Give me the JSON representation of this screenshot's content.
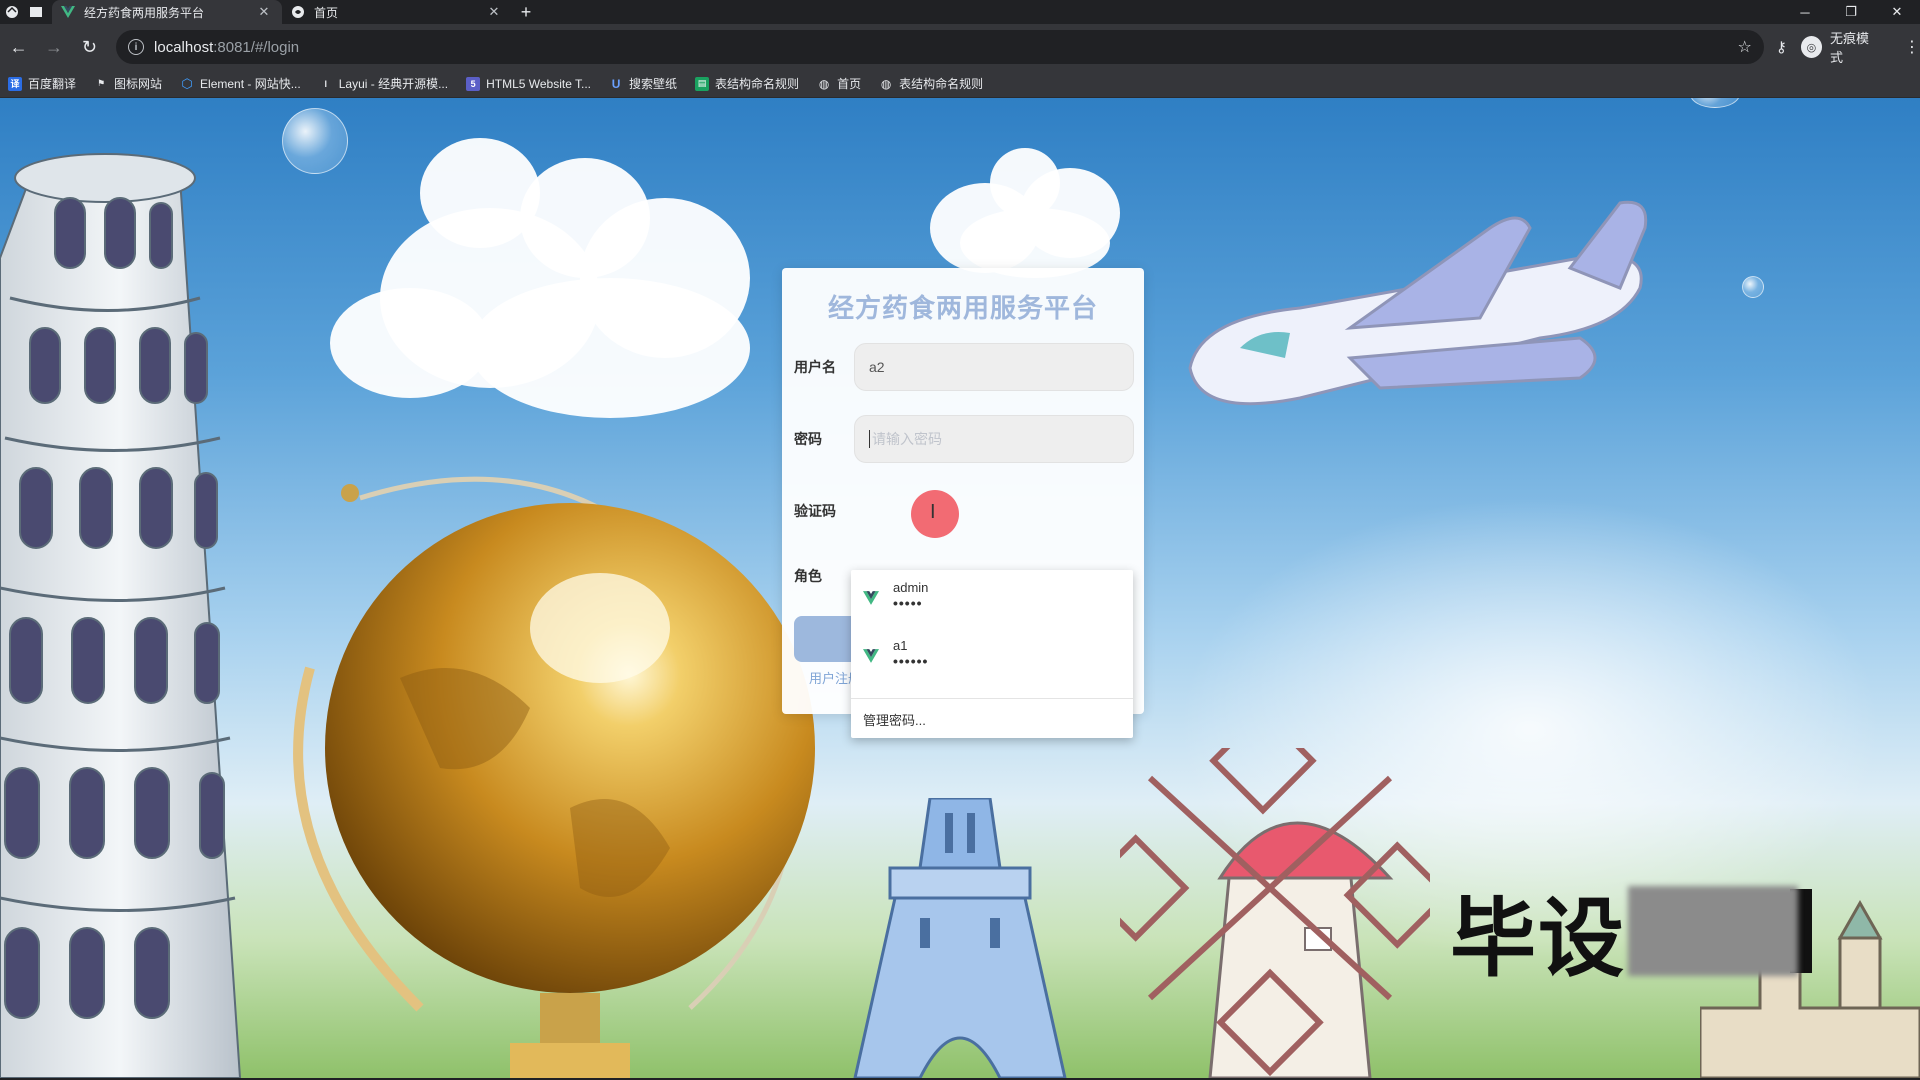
{
  "browser": {
    "tabs": [
      {
        "title": "经方药食两用服务平台",
        "active": true,
        "icon": "vue-logo-icon"
      },
      {
        "title": "首页",
        "active": false,
        "icon": "globe-icon"
      }
    ],
    "close_glyph": "✕",
    "new_tab_glyph": "+",
    "address": {
      "host": "localhost",
      "path": ":8081/#/login"
    },
    "profile_label": "无痕模式",
    "bookmarks": [
      {
        "label": "百度翻译",
        "icon": "translate-icon",
        "color": "#2b6de5"
      },
      {
        "label": "图标网站",
        "icon": "flag-icon",
        "color": "#e8eaed"
      },
      {
        "label": "Element - 网站快...",
        "icon": "element-hex-icon",
        "color": "#409eff"
      },
      {
        "label": "Layui - 经典开源模...",
        "icon": "layui-icon",
        "color": "#5a5a5a"
      },
      {
        "label": "HTML5 Website T...",
        "icon": "html5-icon",
        "color": "#5b5fc7"
      },
      {
        "label": "搜索壁纸",
        "icon": "wallpaper-icon",
        "color": "#3a6fd8"
      },
      {
        "label": "表结构命名规则",
        "icon": "doc-green-icon",
        "color": "#1aa260"
      },
      {
        "label": "首页",
        "icon": "globe-icon",
        "color": "#e8eaed"
      },
      {
        "label": "表结构命名规则",
        "icon": "globe-icon",
        "color": "#e8eaed"
      }
    ]
  },
  "login": {
    "title": "经方药食两用服务平台",
    "username_label": "用户名",
    "username_value": "a2",
    "password_label": "密码",
    "password_placeholder": "请输入密码",
    "captcha_label": "验证码",
    "role_label": "角色",
    "login_button": "login",
    "register_link": "用户注册"
  },
  "password_dropdown": {
    "items": [
      {
        "username": "admin",
        "masked": "•••••"
      },
      {
        "username": "a1",
        "masked": "••••••"
      }
    ],
    "manage_label": "管理密码..."
  },
  "watermark": {
    "text": "毕设"
  },
  "colors": {
    "card_title": "#9fb7dc",
    "button": "#9db8dd",
    "link": "#7fa4d6",
    "cursor_highlight": "#f04650"
  }
}
